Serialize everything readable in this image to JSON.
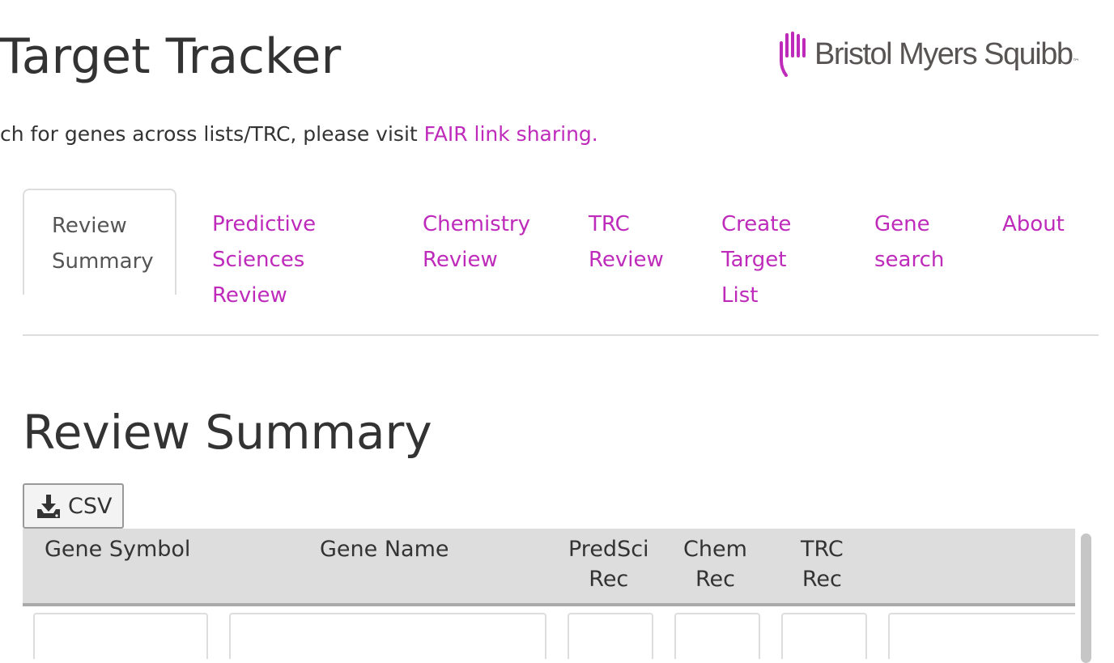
{
  "header": {
    "title": "Target Tracker",
    "logo_text": "Bristol Myers Squibb",
    "logo_tm": "™"
  },
  "intro": {
    "text": "ch for genes across lists/TRC, please visit ",
    "link_label": "FAIR link sharing."
  },
  "tabs": [
    {
      "label_lines": [
        "Review",
        "Summary"
      ],
      "active": true
    },
    {
      "label_lines": [
        "Predictive",
        "Sciences",
        "Review"
      ],
      "active": false
    },
    {
      "label_lines": [
        "Chemistry",
        "Review"
      ],
      "active": false
    },
    {
      "label_lines": [
        "TRC",
        "Review"
      ],
      "active": false
    },
    {
      "label_lines": [
        "Create",
        "Target",
        "List"
      ],
      "active": false
    },
    {
      "label_lines": [
        "Gene",
        "search"
      ],
      "active": false
    },
    {
      "label_lines": [
        "About"
      ],
      "active": false
    }
  ],
  "section": {
    "title": "Review Summary"
  },
  "toolbar": {
    "csv_label": "CSV",
    "csv_icon": "download-icon"
  },
  "table": {
    "columns": [
      {
        "label_lines": [
          "Gene Symbol"
        ]
      },
      {
        "label_lines": [
          "Gene Name"
        ]
      },
      {
        "label_lines": [
          "PredSci",
          "Rec"
        ]
      },
      {
        "label_lines": [
          "Chem",
          "Rec"
        ]
      },
      {
        "label_lines": [
          "TRC",
          "Rec"
        ]
      }
    ]
  },
  "colors": {
    "accent": "#be2bbb",
    "text": "#333333",
    "header_bg": "#dddddd",
    "logo_mark": "#be2bbb"
  }
}
